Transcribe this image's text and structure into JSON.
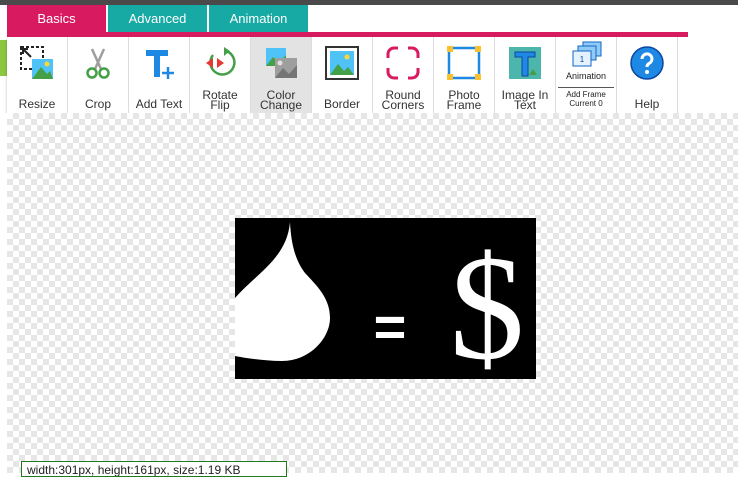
{
  "tabs": [
    {
      "label": "Basics",
      "active": true
    },
    {
      "label": "Advanced",
      "active": false
    },
    {
      "label": "Animation",
      "active": false
    }
  ],
  "tools": {
    "resize": "Resize",
    "crop": "Crop",
    "add_text": "Add Text",
    "rotate_flip": [
      "Rotate",
      "Flip"
    ],
    "color_change": [
      "Color",
      "Change"
    ],
    "border": "Border",
    "round_corners": [
      "Round",
      "Corners"
    ],
    "photo_frame": [
      "Photo",
      "Frame"
    ],
    "image_in_text": [
      "Image In",
      "Text"
    ],
    "animation": {
      "label": "Animation",
      "add_frame": "Add Frame",
      "current": "Current 0",
      "frame_number": "1"
    },
    "help": "Help"
  },
  "active_tool": "Color Change",
  "canvas": {
    "image_text": {
      "equals": "=",
      "dollar": "$"
    }
  },
  "status": "width:301px, height:161px, size:1.19 KB",
  "colors": {
    "tab_active": "#d81b60",
    "tab_inactive": "#17a9a3",
    "image_background": "#000000",
    "image_foreground": "#ffffff"
  }
}
